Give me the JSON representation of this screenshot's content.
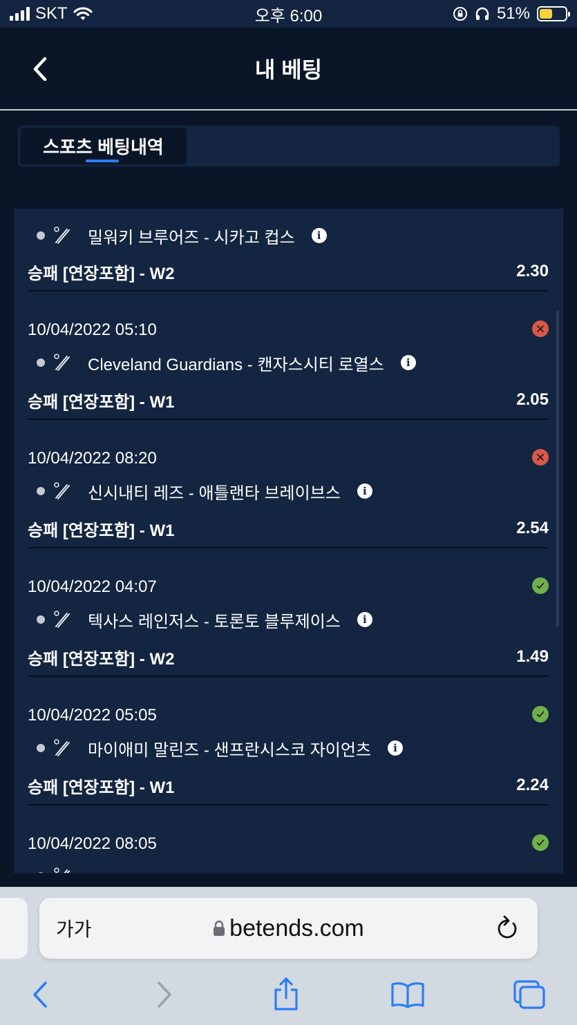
{
  "status_bar": {
    "carrier": "SKT",
    "time": "오후 6:00",
    "battery_pct": "51%"
  },
  "header": {
    "title": "내 베팅"
  },
  "tabs": [
    {
      "label": "스포츠 베팅내역",
      "active": true
    }
  ],
  "bets": [
    {
      "date": "",
      "status": "",
      "match": "밀워키 브루어즈 - 시카고 컵스",
      "market": "승패 [연장포함] - W2",
      "odds": "2.30"
    },
    {
      "date": "10/04/2022 05:10",
      "status": "lost",
      "match": "Cleveland Guardians - 캔자스시티 로열스",
      "market": "승패 [연장포함] - W1",
      "odds": "2.05"
    },
    {
      "date": "10/04/2022 08:20",
      "status": "lost",
      "match": "신시내티 레즈 - 애틀랜타 브레이브스",
      "market": "승패 [연장포함] - W1",
      "odds": "2.54"
    },
    {
      "date": "10/04/2022 04:07",
      "status": "won",
      "match": "텍사스 레인저스 - 토론토 블루제이스",
      "market": "승패 [연장포함] - W2",
      "odds": "1.49"
    },
    {
      "date": "10/04/2022 05:05",
      "status": "won",
      "match": "마이애미 말린즈 - 샌프란시스코 자이언츠",
      "market": "승패 [연장포함] - W1",
      "odds": "2.24"
    },
    {
      "date": "10/04/2022 08:05",
      "status": "won",
      "match": "",
      "market": "",
      "odds": ""
    }
  ],
  "browser": {
    "text_size_label": "가가",
    "url": "betends.com"
  },
  "icons": {
    "status_lost": "x-circle-icon",
    "status_won": "check-circle-icon",
    "sport": "baseball-bat-icon",
    "info": "info-icon"
  },
  "colors": {
    "background": "#0a1628",
    "card": "#132540",
    "accent": "#2f7df6",
    "lost": "#d9584a",
    "won": "#6fb04a"
  }
}
